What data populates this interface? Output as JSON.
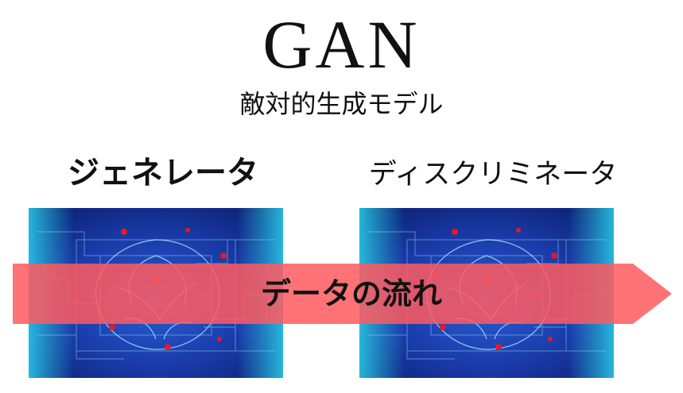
{
  "header": {
    "title": "GAN",
    "subtitle": "敵対的生成モデル"
  },
  "components": {
    "generator_label": "ジェネレータ",
    "discriminator_label": "ディスクリミネータ"
  },
  "images": {
    "generator_image": "circuit-brain",
    "discriminator_image": "circuit-brain"
  },
  "flow": {
    "label": "データの流れ",
    "color": "#ff5a5f",
    "direction": "left-to-right"
  },
  "colors": {
    "panel_blue": "#1f6fd0",
    "panel_cyan": "#29c7e6",
    "panel_dark": "#0a2a7a",
    "node_red": "#e01b24"
  }
}
